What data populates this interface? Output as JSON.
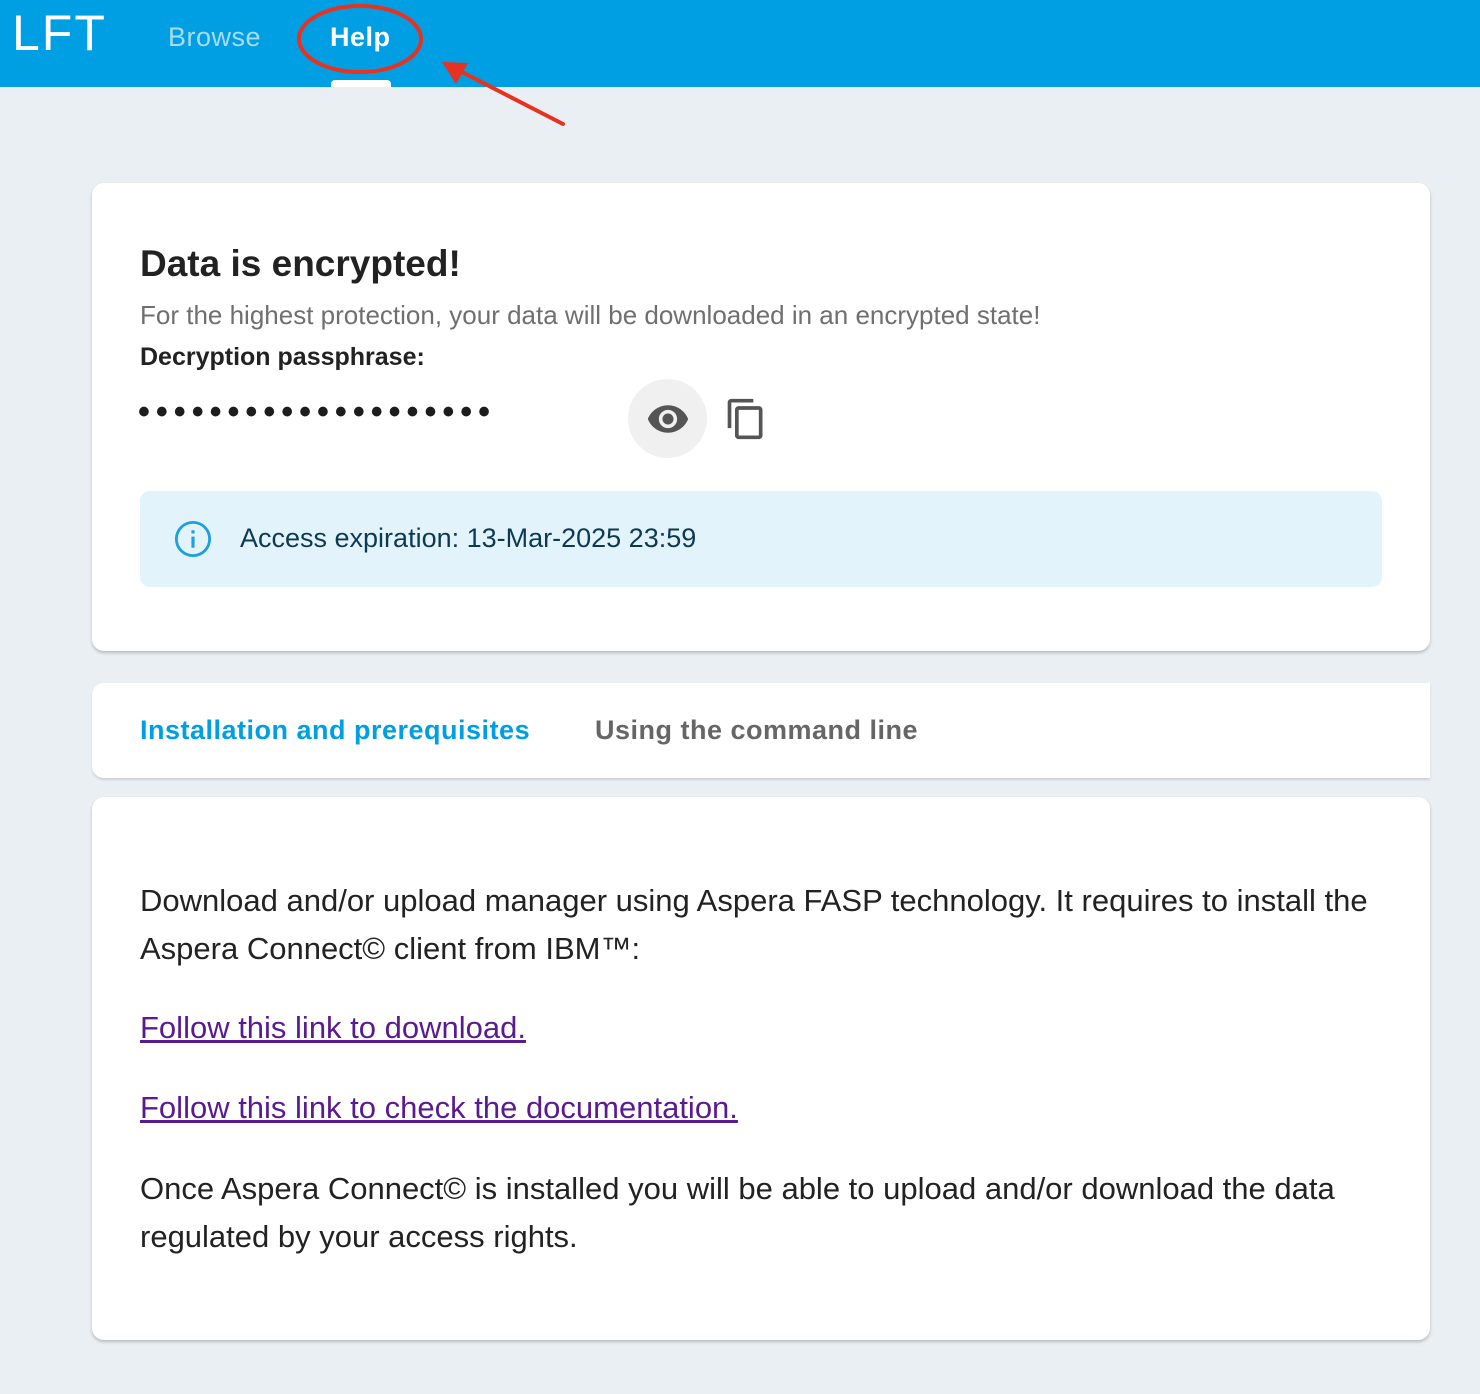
{
  "header": {
    "logo": "LFT",
    "nav": [
      {
        "label": "Browse",
        "active": false
      },
      {
        "label": "Help",
        "active": true
      }
    ],
    "accent_color": "#009ee2"
  },
  "encryption_card": {
    "title": "Data is encrypted!",
    "subtitle": "For the highest protection, your data will be downloaded in an encrypted state!",
    "passphrase_label": "Decryption passphrase:",
    "passphrase_masked": "••••••••••••••••••••",
    "show_icon": "eye-icon",
    "copy_icon": "copy-icon",
    "info_icon": "info-icon",
    "info_text": "Access expiration: 13-Mar-2025 23:59"
  },
  "tabs": [
    {
      "label": "Installation and prerequisites",
      "active": true
    },
    {
      "label": "Using the command line",
      "active": false
    }
  ],
  "help_content": {
    "intro": "Download and/or upload manager using Aspera FASP technology. It requires to install the Aspera Connect© client from IBM™:",
    "download_link": "Follow this link to download.",
    "docs_link": "Follow this link to check the documentation.",
    "outro": "Once Aspera Connect© is installed you will be able to upload and/or download the data regulated by your access rights."
  },
  "annotation_color": "#e8321f"
}
